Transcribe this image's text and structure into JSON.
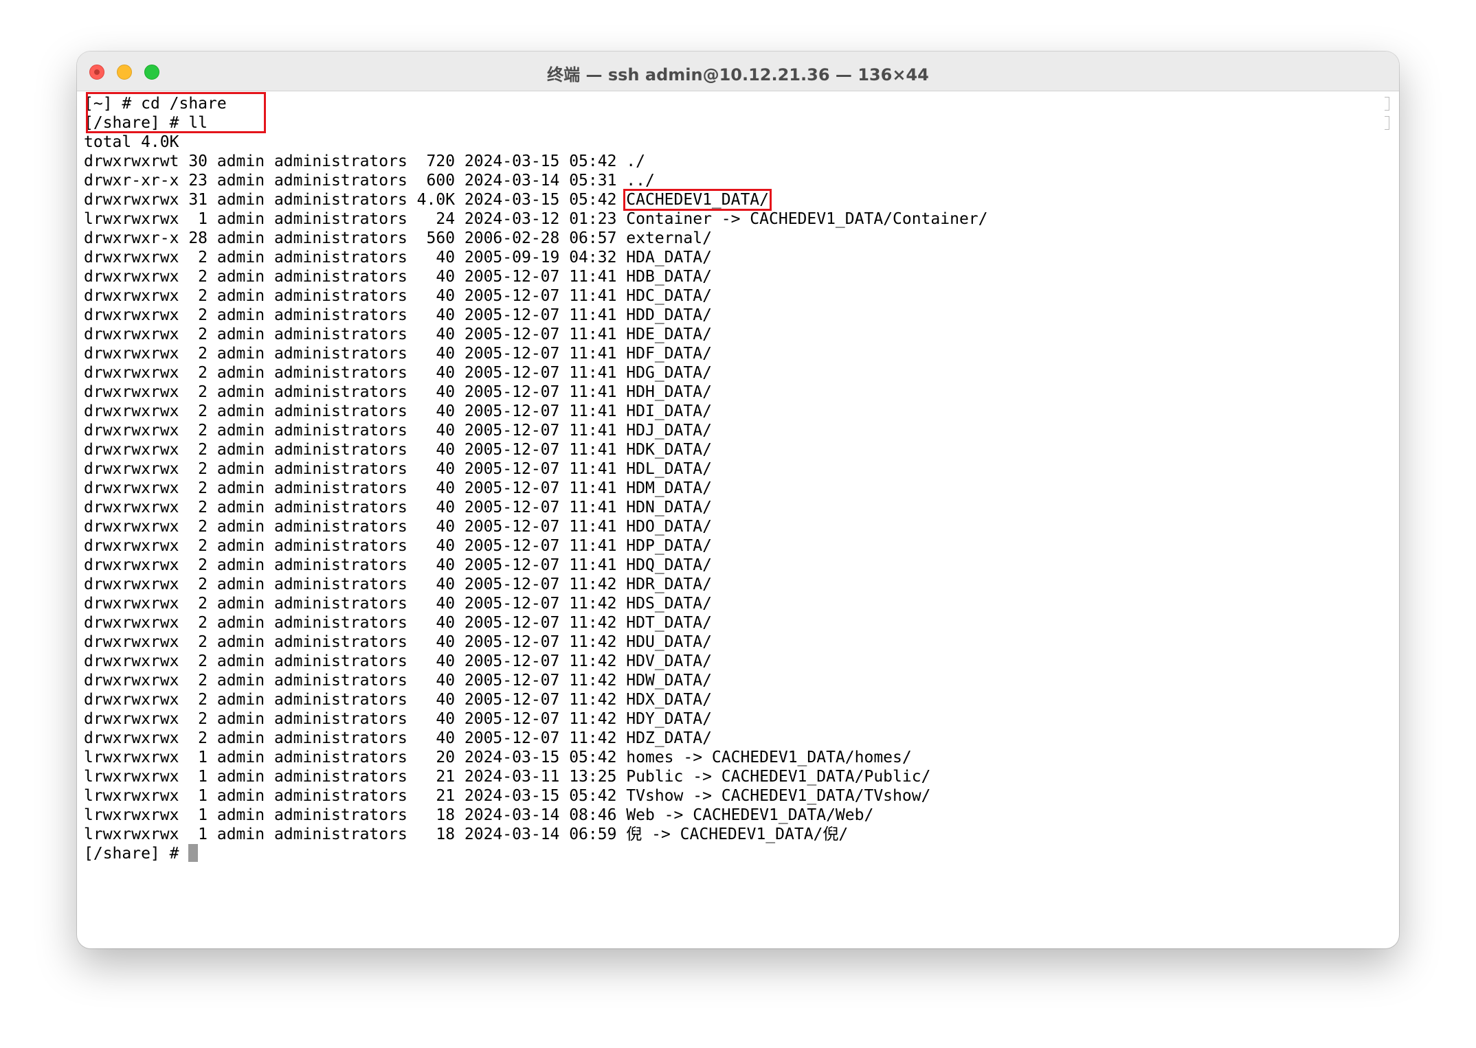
{
  "window": {
    "title": "终端 — ssh admin@10.12.21.36 — 136×44"
  },
  "terminal": {
    "commands": [
      {
        "prompt": "[~] # ",
        "command": "cd /share"
      },
      {
        "prompt": "[/share] # ",
        "command": "ll"
      }
    ],
    "total_line": "total 4.0K",
    "listing": [
      {
        "meta": "drwxrwxrwt 30 admin administrators  720 2024-03-15 05:42 ",
        "name": "./",
        "highlight": false
      },
      {
        "meta": "drwxr-xr-x 23 admin administrators  600 2024-03-14 05:31 ",
        "name": "../",
        "highlight": false
      },
      {
        "meta": "drwxrwxrwx 31 admin administrators 4.0K 2024-03-15 05:42 ",
        "name": "CACHEDEV1_DATA/",
        "highlight": true
      },
      {
        "meta": "lrwxrwxrwx  1 admin administrators   24 2024-03-12 01:23 ",
        "name": "Container -> CACHEDEV1_DATA/Container/",
        "highlight": false
      },
      {
        "meta": "drwxrwxr-x 28 admin administrators  560 2006-02-28 06:57 ",
        "name": "external/",
        "highlight": false
      },
      {
        "meta": "drwxrwxrwx  2 admin administrators   40 2005-09-19 04:32 ",
        "name": "HDA_DATA/",
        "highlight": false
      },
      {
        "meta": "drwxrwxrwx  2 admin administrators   40 2005-12-07 11:41 ",
        "name": "HDB_DATA/",
        "highlight": false
      },
      {
        "meta": "drwxrwxrwx  2 admin administrators   40 2005-12-07 11:41 ",
        "name": "HDC_DATA/",
        "highlight": false
      },
      {
        "meta": "drwxrwxrwx  2 admin administrators   40 2005-12-07 11:41 ",
        "name": "HDD_DATA/",
        "highlight": false
      },
      {
        "meta": "drwxrwxrwx  2 admin administrators   40 2005-12-07 11:41 ",
        "name": "HDE_DATA/",
        "highlight": false
      },
      {
        "meta": "drwxrwxrwx  2 admin administrators   40 2005-12-07 11:41 ",
        "name": "HDF_DATA/",
        "highlight": false
      },
      {
        "meta": "drwxrwxrwx  2 admin administrators   40 2005-12-07 11:41 ",
        "name": "HDG_DATA/",
        "highlight": false
      },
      {
        "meta": "drwxrwxrwx  2 admin administrators   40 2005-12-07 11:41 ",
        "name": "HDH_DATA/",
        "highlight": false
      },
      {
        "meta": "drwxrwxrwx  2 admin administrators   40 2005-12-07 11:41 ",
        "name": "HDI_DATA/",
        "highlight": false
      },
      {
        "meta": "drwxrwxrwx  2 admin administrators   40 2005-12-07 11:41 ",
        "name": "HDJ_DATA/",
        "highlight": false
      },
      {
        "meta": "drwxrwxrwx  2 admin administrators   40 2005-12-07 11:41 ",
        "name": "HDK_DATA/",
        "highlight": false
      },
      {
        "meta": "drwxrwxrwx  2 admin administrators   40 2005-12-07 11:41 ",
        "name": "HDL_DATA/",
        "highlight": false
      },
      {
        "meta": "drwxrwxrwx  2 admin administrators   40 2005-12-07 11:41 ",
        "name": "HDM_DATA/",
        "highlight": false
      },
      {
        "meta": "drwxrwxrwx  2 admin administrators   40 2005-12-07 11:41 ",
        "name": "HDN_DATA/",
        "highlight": false
      },
      {
        "meta": "drwxrwxrwx  2 admin administrators   40 2005-12-07 11:41 ",
        "name": "HDO_DATA/",
        "highlight": false
      },
      {
        "meta": "drwxrwxrwx  2 admin administrators   40 2005-12-07 11:41 ",
        "name": "HDP_DATA/",
        "highlight": false
      },
      {
        "meta": "drwxrwxrwx  2 admin administrators   40 2005-12-07 11:41 ",
        "name": "HDQ_DATA/",
        "highlight": false
      },
      {
        "meta": "drwxrwxrwx  2 admin administrators   40 2005-12-07 11:42 ",
        "name": "HDR_DATA/",
        "highlight": false
      },
      {
        "meta": "drwxrwxrwx  2 admin administrators   40 2005-12-07 11:42 ",
        "name": "HDS_DATA/",
        "highlight": false
      },
      {
        "meta": "drwxrwxrwx  2 admin administrators   40 2005-12-07 11:42 ",
        "name": "HDT_DATA/",
        "highlight": false
      },
      {
        "meta": "drwxrwxrwx  2 admin administrators   40 2005-12-07 11:42 ",
        "name": "HDU_DATA/",
        "highlight": false
      },
      {
        "meta": "drwxrwxrwx  2 admin administrators   40 2005-12-07 11:42 ",
        "name": "HDV_DATA/",
        "highlight": false
      },
      {
        "meta": "drwxrwxrwx  2 admin administrators   40 2005-12-07 11:42 ",
        "name": "HDW_DATA/",
        "highlight": false
      },
      {
        "meta": "drwxrwxrwx  2 admin administrators   40 2005-12-07 11:42 ",
        "name": "HDX_DATA/",
        "highlight": false
      },
      {
        "meta": "drwxrwxrwx  2 admin administrators   40 2005-12-07 11:42 ",
        "name": "HDY_DATA/",
        "highlight": false
      },
      {
        "meta": "drwxrwxrwx  2 admin administrators   40 2005-12-07 11:42 ",
        "name": "HDZ_DATA/",
        "highlight": false
      },
      {
        "meta": "lrwxrwxrwx  1 admin administrators   20 2024-03-15 05:42 ",
        "name": "homes -> CACHEDEV1_DATA/homes/",
        "highlight": false
      },
      {
        "meta": "lrwxrwxrwx  1 admin administrators   21 2024-03-11 13:25 ",
        "name": "Public -> CACHEDEV1_DATA/Public/",
        "highlight": false
      },
      {
        "meta": "lrwxrwxrwx  1 admin administrators   21 2024-03-15 05:42 ",
        "name": "TVshow -> CACHEDEV1_DATA/TVshow/",
        "highlight": false
      },
      {
        "meta": "lrwxrwxrwx  1 admin administrators   18 2024-03-14 08:46 ",
        "name": "Web -> CACHEDEV1_DATA/Web/",
        "highlight": false
      },
      {
        "meta": "lrwxrwxrwx  1 admin administrators   18 2024-03-14 06:59 ",
        "name": "倪 -> CACHEDEV1_DATA/倪/",
        "highlight": false
      }
    ],
    "final_prompt": "[/share] # "
  },
  "colors": {
    "highlight_box": "#e4141b",
    "titlebar": "#ebebeb",
    "text": "#000000",
    "cursor": "#9a9a9a"
  }
}
